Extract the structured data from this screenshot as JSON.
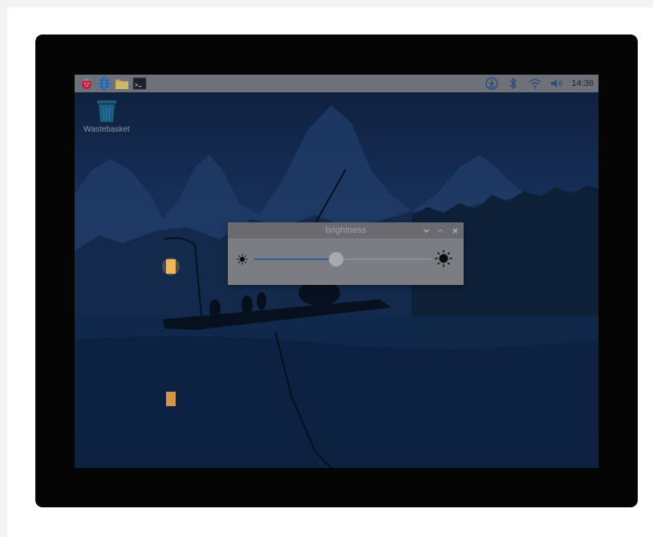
{
  "taskbar": {
    "launchers": [
      "raspberry-menu-icon",
      "web-browser-icon",
      "file-manager-icon",
      "terminal-icon"
    ],
    "tray": [
      "download-icon",
      "bluetooth-icon",
      "wifi-icon",
      "volume-icon"
    ],
    "clock": "14:36"
  },
  "desktop": {
    "icons": [
      {
        "label": "Wastebasket",
        "icon": "wastebasket-icon"
      }
    ]
  },
  "dialog": {
    "title": "brightness",
    "controls": [
      "minimize-icon",
      "maximize-icon",
      "close-icon"
    ],
    "brightness_level": 0.46
  },
  "colors": {
    "taskbar": "#6f7178",
    "dialog": "#7c7d83",
    "slider_accent": "#2d5c9c"
  }
}
